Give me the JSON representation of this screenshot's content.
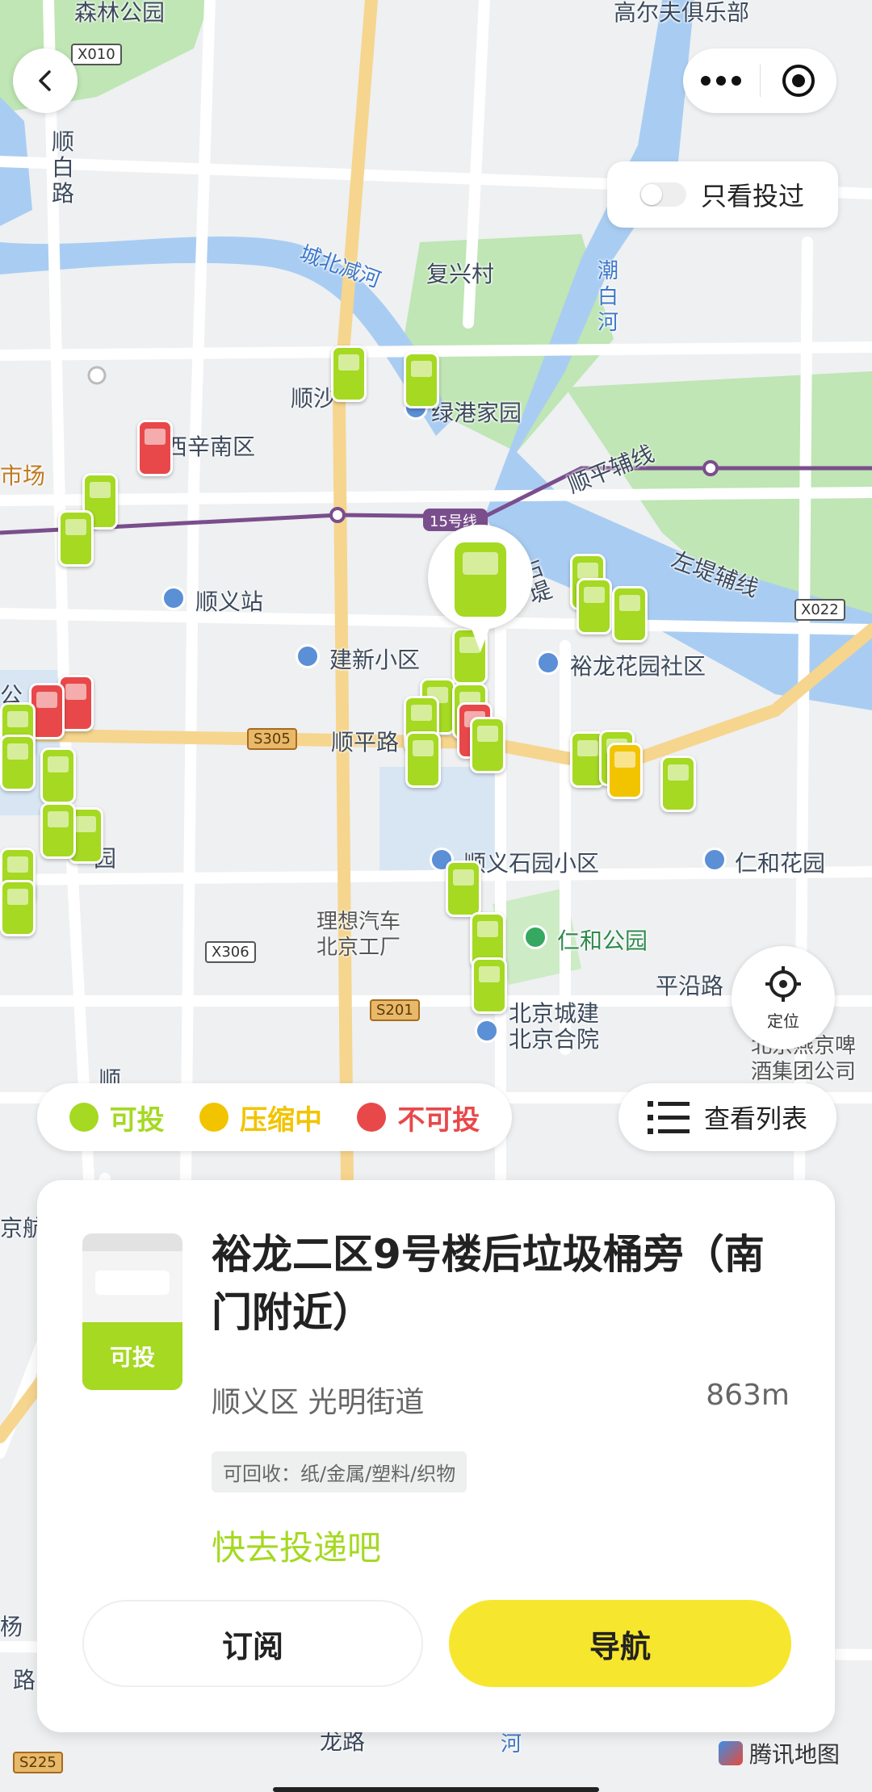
{
  "map": {
    "labels": [
      "森林公园",
      "高尔夫俱乐部",
      "顺白路",
      "城北减河",
      "复兴村",
      "潮白河",
      "顺沙",
      "绿港家园",
      "西辛南区",
      "市场",
      "15号线",
      "顺平辅线",
      "左堤辅线",
      "顺义站",
      "建新小区",
      "裕龙花园社区",
      "右堤",
      "顺平路",
      "公",
      "园",
      "顺义石园小区",
      "仁和花园",
      "理想汽车北京工厂",
      "仁和公园",
      "平沿路",
      "北京城建北京合院",
      "北京燕京啤酒集团公司",
      "顺",
      "京航空",
      "杨",
      "龙路",
      "河",
      "路"
    ],
    "shields": [
      "X010",
      "X022",
      "S305",
      "X306",
      "S201",
      "S225"
    ]
  },
  "top": {
    "back_icon": "chevron-left-icon",
    "more_icon": "more-dots-icon",
    "record_icon": "target-icon"
  },
  "toggle": {
    "label": "只看投过",
    "on": false
  },
  "locate": {
    "label": "定位"
  },
  "legend": [
    {
      "label": "可投",
      "color": "#a5d922"
    },
    {
      "label": "压缩中",
      "color": "#f2c400"
    },
    {
      "label": "不可投",
      "color": "#e8484a"
    }
  ],
  "list_button": {
    "label": "查看列表"
  },
  "card": {
    "status": "可投",
    "title": "裕龙二区9号楼后垃圾桶旁（南门附近）",
    "location": "顺义区 光明街道",
    "distance": "863m",
    "recyclables": "可回收：纸/金属/塑料/织物",
    "hint": "快去投递吧",
    "subscribe_label": "订阅",
    "navigate_label": "导航"
  },
  "brand": "腾讯地图"
}
